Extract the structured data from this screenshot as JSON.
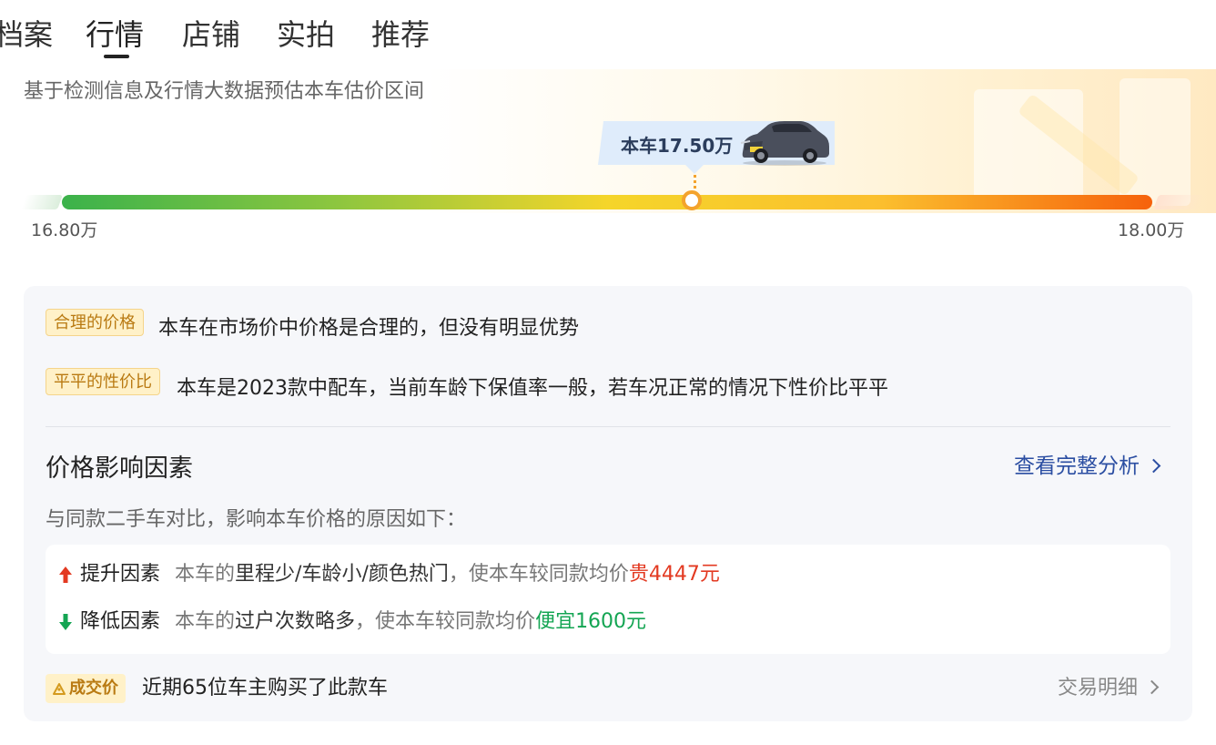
{
  "tabs": [
    {
      "label": "档案",
      "active": false
    },
    {
      "label": "行情",
      "active": true
    },
    {
      "label": "店铺",
      "active": false
    },
    {
      "label": "实拍",
      "active": false
    },
    {
      "label": "推荐",
      "active": false
    }
  ],
  "price": {
    "description": "基于检测信息及行情大数据预估本车估价区间",
    "current_label": "本车17.50万",
    "current_value": 17.5,
    "min_label": "16.80万",
    "max_label": "18.00万",
    "min_value": 16.8,
    "max_value": 18.0
  },
  "evaluation": [
    {
      "tag": "合理的价格",
      "text": "本车在市场价中价格是合理的，但没有明显优势"
    },
    {
      "tag": "平平的性价比",
      "text": "本车是2023款中配车，当前车龄下保值率一般，若车况正常的情况下性价比平平"
    }
  ],
  "factors": {
    "title": "价格影响因素",
    "link": "查看完整分析",
    "subtitle": "与同款二手车对比，影响本车价格的原因如下：",
    "up": {
      "label": "提升因素",
      "prefix": "本车的",
      "items": "里程少/车龄小/颜色热门",
      "middle": "，使本车较同款均价",
      "result": "贵4447元"
    },
    "down": {
      "label": "降低因素",
      "prefix": "本车的",
      "items": "过户次数略多",
      "middle": "，使本车较同款均价",
      "result": "便宜1600元"
    }
  },
  "deal": {
    "tag": "成交价",
    "text": "近期65位车主购买了此款车",
    "link": "交易明细"
  },
  "colors": {
    "accent_blue": "#2b4ea2",
    "up_red": "#e33a22",
    "down_green": "#14a553",
    "tag_bg": "#fff1c8",
    "tag_text": "#b97a12"
  }
}
